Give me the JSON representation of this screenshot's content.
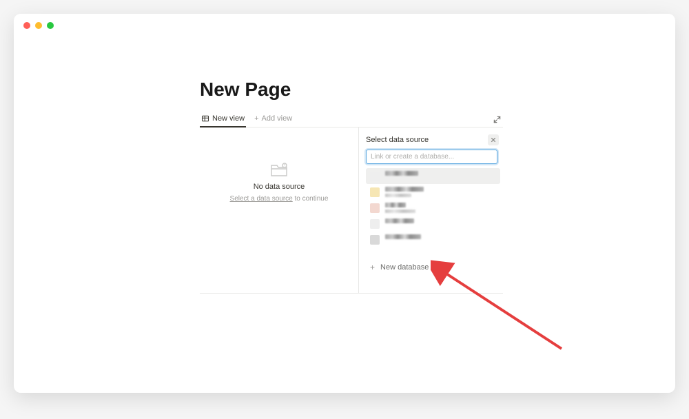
{
  "page": {
    "title": "New Page"
  },
  "tabs": {
    "active_label": "New view",
    "add_label": "Add view"
  },
  "empty_state": {
    "title": "No data source",
    "link_text": "Select a data source",
    "suffix": " to continue"
  },
  "popover": {
    "title": "Select data source",
    "search_placeholder": "Link or create a database...",
    "new_database_label": "New database"
  }
}
